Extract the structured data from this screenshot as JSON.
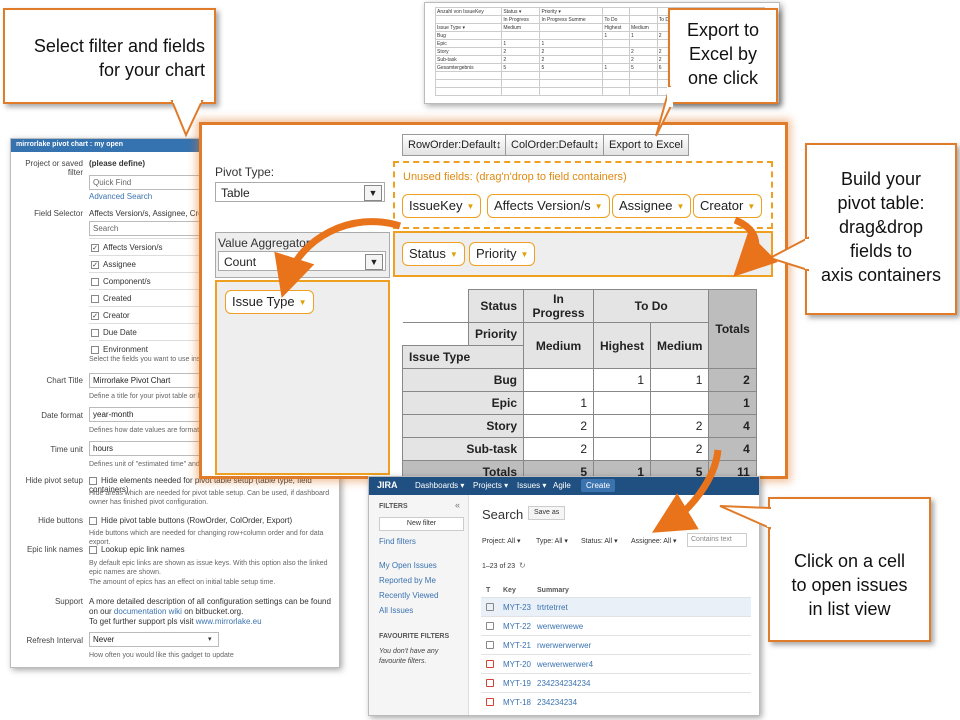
{
  "callouts": {
    "filter": [
      "Select filter and fields",
      "for your chart"
    ],
    "export": [
      "Export to",
      "Excel by",
      "one click"
    ],
    "build": [
      "Build your",
      "pivot table:",
      "drag&drop",
      "fields to",
      "axis containers"
    ],
    "click": [
      "Click on a cell",
      "to open issues",
      "in list view"
    ]
  },
  "config": {
    "header": "mirrorlake pivot chart : my open",
    "project_label": "Project or saved filter",
    "project_value": "(please define)",
    "quick_find_placeholder": "Quick Find",
    "advanced_search": "Advanced Search",
    "field_selector_label": "Field Selector",
    "field_selector_value": "Affects Version/s, Assignee, Creator",
    "search_placeholder": "Search",
    "fields": [
      {
        "label": "Affects Version/s",
        "checked": true
      },
      {
        "label": "Assignee",
        "checked": true
      },
      {
        "label": "Component/s",
        "checked": false
      },
      {
        "label": "Created",
        "checked": false
      },
      {
        "label": "Creator",
        "checked": true
      },
      {
        "label": "Due Date",
        "checked": false
      },
      {
        "label": "Environment",
        "checked": false
      }
    ],
    "fields_desc": "Select the fields you want to use inside t",
    "title_label": "Chart Title",
    "title_value": "Mirrorlake Pivot Chart",
    "title_desc": "Define a title for your pivot table or leave",
    "date_label": "Date format",
    "date_value": "year-month",
    "date_desc": "Defines how date values are formatted in",
    "time_label": "Time unit",
    "time_value": "hours",
    "time_desc": "Defines unit of \"estimated time\" and \"spe",
    "hide_setup_label": "Hide pivot setup",
    "hide_setup_text": "Hide elements needed for pivot table setup (table type, field containers)",
    "hide_setup_desc": "Hide areas which are needed for pivot table setup. Can be used, if dashboard owner has finished pivot configuration.",
    "hide_buttons_label": "Hide buttons",
    "hide_buttons_text": "Hide pivot table buttons (RowOrder, ColOrder, Export)",
    "hide_buttons_desc": "Hide buttons which are needed for changing row+column order and for data export.",
    "epic_label": "Epic link names",
    "epic_text": "Lookup epic link names",
    "epic_desc1": "By default epic links are shown as issue keys. With this option also the linked epic names are shown.",
    "epic_desc2": "The amount of epics has an effect on initial table setup time.",
    "support_label": "Support",
    "support_text1": "A more detailed description of all configuration settings can be found on our",
    "support_link1": "documentation wiki",
    "support_text2": "on bitbucket.org.",
    "support_text3": "To get further support pls visit",
    "support_link2": "www.mirrorlake.eu",
    "refresh_label": "Refresh Interval",
    "refresh_value": "Never",
    "refresh_desc": "How often you would like this gadget to update"
  },
  "pivot": {
    "buttons": {
      "row_order": "RowOrder:Default↕",
      "col_order": "ColOrder:Default↕",
      "export": "Export to Excel"
    },
    "pivot_type_label": "Pivot Type:",
    "pivot_type_value": "Table",
    "unused_label": "Unused fields: (drag'n'drop to field containers)",
    "unused_fields": [
      "IssueKey",
      "Affects Version/s",
      "Assignee",
      "Creator"
    ],
    "aggregator_label": "Value Aggregator:",
    "aggregator_value": "Count",
    "col_fields": [
      "Status",
      "Priority"
    ],
    "row_fields": [
      "Issue Type"
    ],
    "table": {
      "status_label": "Status",
      "priority_label": "Priority",
      "row_axis_label": "Issue Type",
      "status_groups": [
        "In Progress",
        "To Do"
      ],
      "priorities": [
        "Medium",
        "Highest",
        "Medium"
      ],
      "totals_label": "Totals",
      "rows": [
        {
          "name": "Bug",
          "cells": [
            "",
            "1",
            "1"
          ],
          "total": "2"
        },
        {
          "name": "Epic",
          "cells": [
            "1",
            "",
            ""
          ],
          "total": "1"
        },
        {
          "name": "Story",
          "cells": [
            "2",
            "",
            "2"
          ],
          "total": "4"
        },
        {
          "name": "Sub-task",
          "cells": [
            "2",
            "",
            "2"
          ],
          "total": "4"
        }
      ],
      "col_totals": [
        "5",
        "1",
        "5"
      ],
      "grand_total": "11"
    }
  },
  "excel": {
    "cells": [
      [
        "Anzahl von IssueKey",
        "Status ▾",
        "Priority ▾",
        "",
        "",
        "",
        "",
        "",
        ""
      ],
      [
        "",
        "In Progress",
        "In Progress Summe",
        "To Do",
        "",
        "To Do Summe",
        "",
        "",
        "Gesamtergebnis"
      ],
      [
        "Issue Type ▾",
        "Medium",
        "",
        "Highest",
        "Medium",
        "",
        "",
        "",
        ""
      ],
      [
        "Bug",
        "",
        "",
        "1",
        "1",
        "2",
        "",
        "",
        "2"
      ],
      [
        "Epic",
        "1",
        "1",
        "",
        "",
        "",
        "",
        "",
        "1"
      ],
      [
        "Story",
        "2",
        "2",
        "",
        "2",
        "2",
        "",
        "",
        "4"
      ],
      [
        "Sub-task",
        "2",
        "2",
        "",
        "2",
        "2",
        "",
        "",
        "4"
      ],
      [
        "Gesamtergebnis",
        "5",
        "5",
        "1",
        "5",
        "6",
        "",
        "",
        "11"
      ]
    ]
  },
  "jira": {
    "logo": "JIRA",
    "nav": [
      "Dashboards ▾",
      "Projects ▾",
      "Issues ▾",
      "Agile"
    ],
    "create": "Create",
    "filters_heading": "FILTERS",
    "new_filter": "New filter",
    "find_filters": "Find filters",
    "filter_links": [
      "My Open Issues",
      "Reported by Me",
      "Recently Viewed",
      "All Issues"
    ],
    "fav_heading": "FAVOURITE FILTERS",
    "fav_empty": "You don't have any favourite filters.",
    "search_title": "Search",
    "save_as": "Save as",
    "filters": [
      "Project: All ▾",
      "Type: All ▾",
      "Status: All ▾",
      "Assignee: All ▾"
    ],
    "contains_placeholder": "Contains text",
    "count": "1–23 of 23",
    "col_t": "T",
    "col_key": "Key",
    "col_summary": "Summary",
    "issues": [
      {
        "key": "MYT-23",
        "summary": "trtrtetrret",
        "color": "#888888"
      },
      {
        "key": "MYT-22",
        "summary": "werwerwewe",
        "color": "#888888"
      },
      {
        "key": "MYT-21",
        "summary": "rwerwerwerwer",
        "color": "#888888"
      },
      {
        "key": "MYT-20",
        "summary": "werwerwerwer4",
        "color": "#d04437"
      },
      {
        "key": "MYT-19",
        "summary": "234234234234",
        "color": "#d04437"
      },
      {
        "key": "MYT-18",
        "summary": "234234234",
        "color": "#d04437"
      }
    ]
  },
  "colors": {
    "accent": "#e07b2a",
    "jira_blue": "#205081",
    "link": "#3b73af"
  }
}
